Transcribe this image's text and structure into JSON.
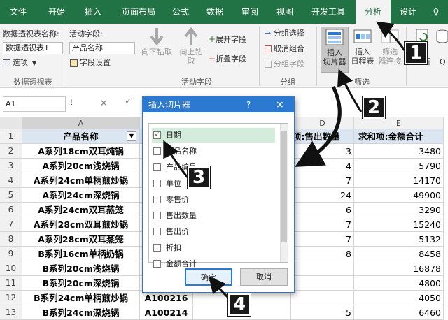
{
  "ribbon_tabs": [
    "文件",
    "开始",
    "插入",
    "页面布局",
    "公式",
    "数据",
    "审阅",
    "视图",
    "开发工具",
    "分析",
    "设计",
    "♀"
  ],
  "ribbon": {
    "pt_name_label": "数据透视表名称:",
    "pt_name_value": "数据透视表1",
    "options_label": "选项",
    "group_pivot": "数据透视表",
    "active_field_label": "活动字段:",
    "active_field_value": "产品名称",
    "field_settings_label": "字段设置",
    "drill_down": "向下钻取",
    "drill_up_1": "向上钻",
    "drill_up_2": "取",
    "expand_field": "展开字段",
    "collapse_field": "折叠字段",
    "group_active_field": "活动字段",
    "group_selection": "分组选择",
    "ungroup": "取消组合",
    "group_field": "分组字段",
    "group_group": "分组",
    "insert_slicer_1": "插入",
    "insert_slicer_2": "切片器",
    "insert_timeline_1": "插入",
    "insert_timeline_2": "日程表",
    "filter_conn_1": "筛选",
    "filter_conn_2": "器连接",
    "group_filter": "筛选",
    "refresh_partial": "新",
    "more_partial": "Q"
  },
  "formula_bar": {
    "name_box": "A1",
    "cancel_icon": "×",
    "enter_icon": "✓"
  },
  "columns": [
    "A",
    "B",
    "C",
    "D",
    "E"
  ],
  "rows": [
    "1",
    "2",
    "3",
    "4",
    "5",
    "6",
    "7",
    "8",
    "9",
    "10",
    "11",
    "12",
    "13"
  ],
  "table": {
    "col_a_header": "产品名称",
    "col_d_header": "项:售出数量",
    "col_e_header": "求和项:金额合计",
    "col_a": [
      "A系列18cm双耳炖锅",
      "A系列20cm浅烧锅",
      "A系列24cm单柄煎炒锅",
      "A系列24cm深烧锅",
      "A系列24cm双耳蒸笼",
      "A系列28cm双耳煎炒锅",
      "A系列28cm双耳蒸笼",
      "B系列16cm单柄奶锅",
      "B系列20cm浅烧锅",
      "B系列20cm深烧锅",
      "B系列24cm单柄煎炒锅",
      "B系列24cm深烧锅"
    ],
    "col_b": [
      "",
      "",
      "",
      "",
      "",
      "",
      "",
      "",
      "",
      "",
      "A100216",
      "A100214"
    ],
    "col_d": [
      "3",
      "4",
      "7",
      "24",
      "6",
      "7",
      "7",
      "8",
      "",
      "",
      "",
      "5"
    ],
    "col_e": [
      "3480",
      "5790",
      "14170",
      "49900",
      "3290",
      "15240",
      "5132",
      "8458",
      "16878",
      "4800",
      "4050",
      "6460"
    ]
  },
  "dialog": {
    "title": "插入切片器",
    "help": "?",
    "close": "×",
    "fields": [
      {
        "label": "日期",
        "checked": true
      },
      {
        "label": "产品名称",
        "checked": false
      },
      {
        "label": "产品编号",
        "checked": false
      },
      {
        "label": "单位",
        "checked": false
      },
      {
        "label": "零售价",
        "checked": false
      },
      {
        "label": "售出数量",
        "checked": false
      },
      {
        "label": "售出价",
        "checked": false
      },
      {
        "label": "折扣",
        "checked": false
      },
      {
        "label": "金额合计",
        "checked": false
      }
    ],
    "ok": "确定",
    "cancel": "取消"
  },
  "callouts": [
    "1",
    "2",
    "3",
    "4"
  ],
  "colors": {
    "ribbon_green": "#217346",
    "dialog_blue": "#2b79d0",
    "header_fill": "#dce6f2",
    "callout_black": "#1a1a1a"
  }
}
